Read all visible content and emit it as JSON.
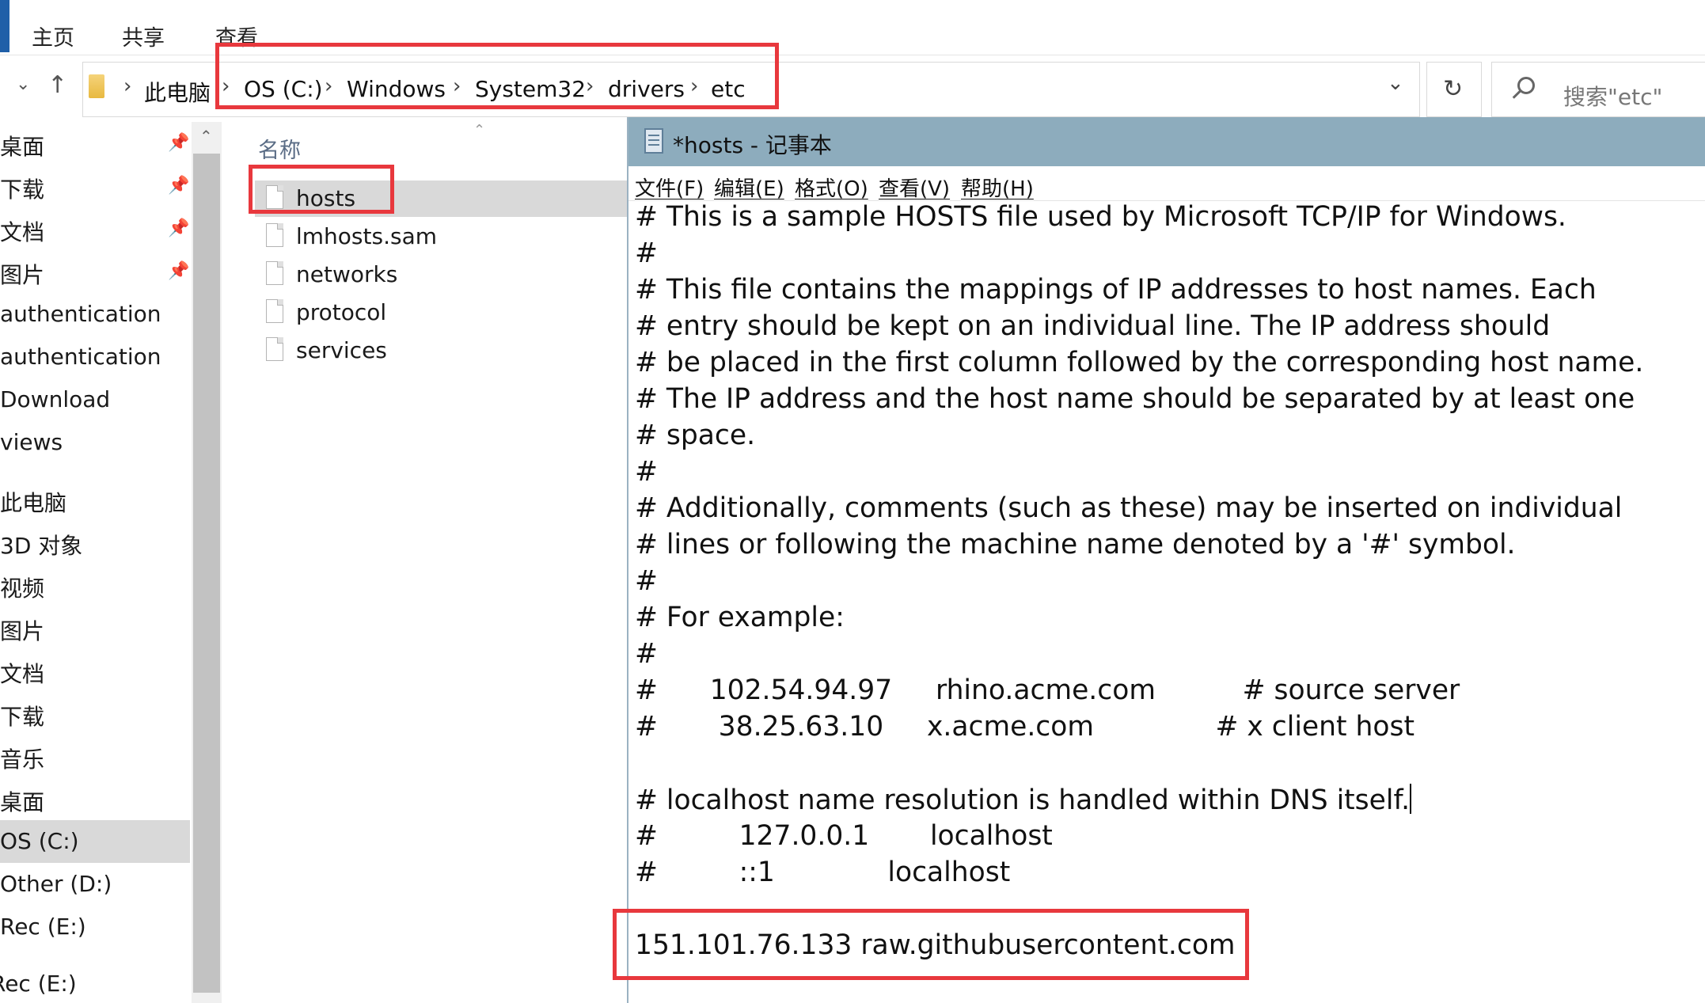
{
  "ribbon": {
    "tabs": [
      "主页",
      "共享",
      "查看"
    ]
  },
  "address": {
    "crumbs": [
      "此电脑",
      "OS (C:)",
      "Windows",
      "System32",
      "drivers",
      "etc"
    ],
    "search_placeholder": "搜索\"etc\""
  },
  "nav": {
    "items": [
      {
        "label": "桌面",
        "pinned": true
      },
      {
        "label": "下载",
        "pinned": true
      },
      {
        "label": "文档",
        "pinned": true
      },
      {
        "label": "图片",
        "pinned": true
      },
      {
        "label": "authentication"
      },
      {
        "label": "authentication"
      },
      {
        "label": "Download"
      },
      {
        "label": "views"
      },
      {
        "label": "此电脑"
      },
      {
        "label": "3D 对象"
      },
      {
        "label": "视频"
      },
      {
        "label": "图片"
      },
      {
        "label": "文档"
      },
      {
        "label": "下载"
      },
      {
        "label": "音乐"
      },
      {
        "label": "桌面"
      },
      {
        "label": "OS (C:)",
        "selected": true
      },
      {
        "label": "Other (D:)"
      },
      {
        "label": "Rec (E:)"
      },
      {
        "label": "Rec (E:)"
      }
    ]
  },
  "files": {
    "column_header": "名称",
    "items": [
      {
        "name": "hosts",
        "selected": true
      },
      {
        "name": "lmhosts.sam"
      },
      {
        "name": "networks"
      },
      {
        "name": "protocol"
      },
      {
        "name": "services"
      }
    ]
  },
  "notepad": {
    "title": "*hosts - 记事本",
    "menu": [
      "文件(F)",
      "编辑(E)",
      "格式(O)",
      "查看(V)",
      "帮助(H)"
    ],
    "lines": [
      "# This is a sample HOSTS file used by Microsoft TCP/IP for Windows.",
      "#",
      "# This file contains the mappings of IP addresses to host names. Each",
      "# entry should be kept on an individual line. The IP address should",
      "# be placed in the first column followed by the corresponding host name.",
      "# The IP address and the host name should be separated by at least one",
      "# space.",
      "#",
      "# Additionally, comments (such as these) may be inserted on individual",
      "# lines or following the machine name denoted by a '#' symbol.",
      "#",
      "# For example:",
      "#",
      "#      102.54.94.97     rhino.acme.com          # source server",
      "#       38.25.63.10     x.acme.com              # x client host",
      "",
      "# localhost name resolution is handled within DNS itself.",
      "#\t127.0.0.1       localhost",
      "#\t::1             localhost",
      "",
      "151.101.76.133 raw.githubusercontent.com"
    ]
  },
  "colors": {
    "highlight": "#e8383d",
    "title_bar": "#8dacbd",
    "selection": "#d9d9d9"
  }
}
